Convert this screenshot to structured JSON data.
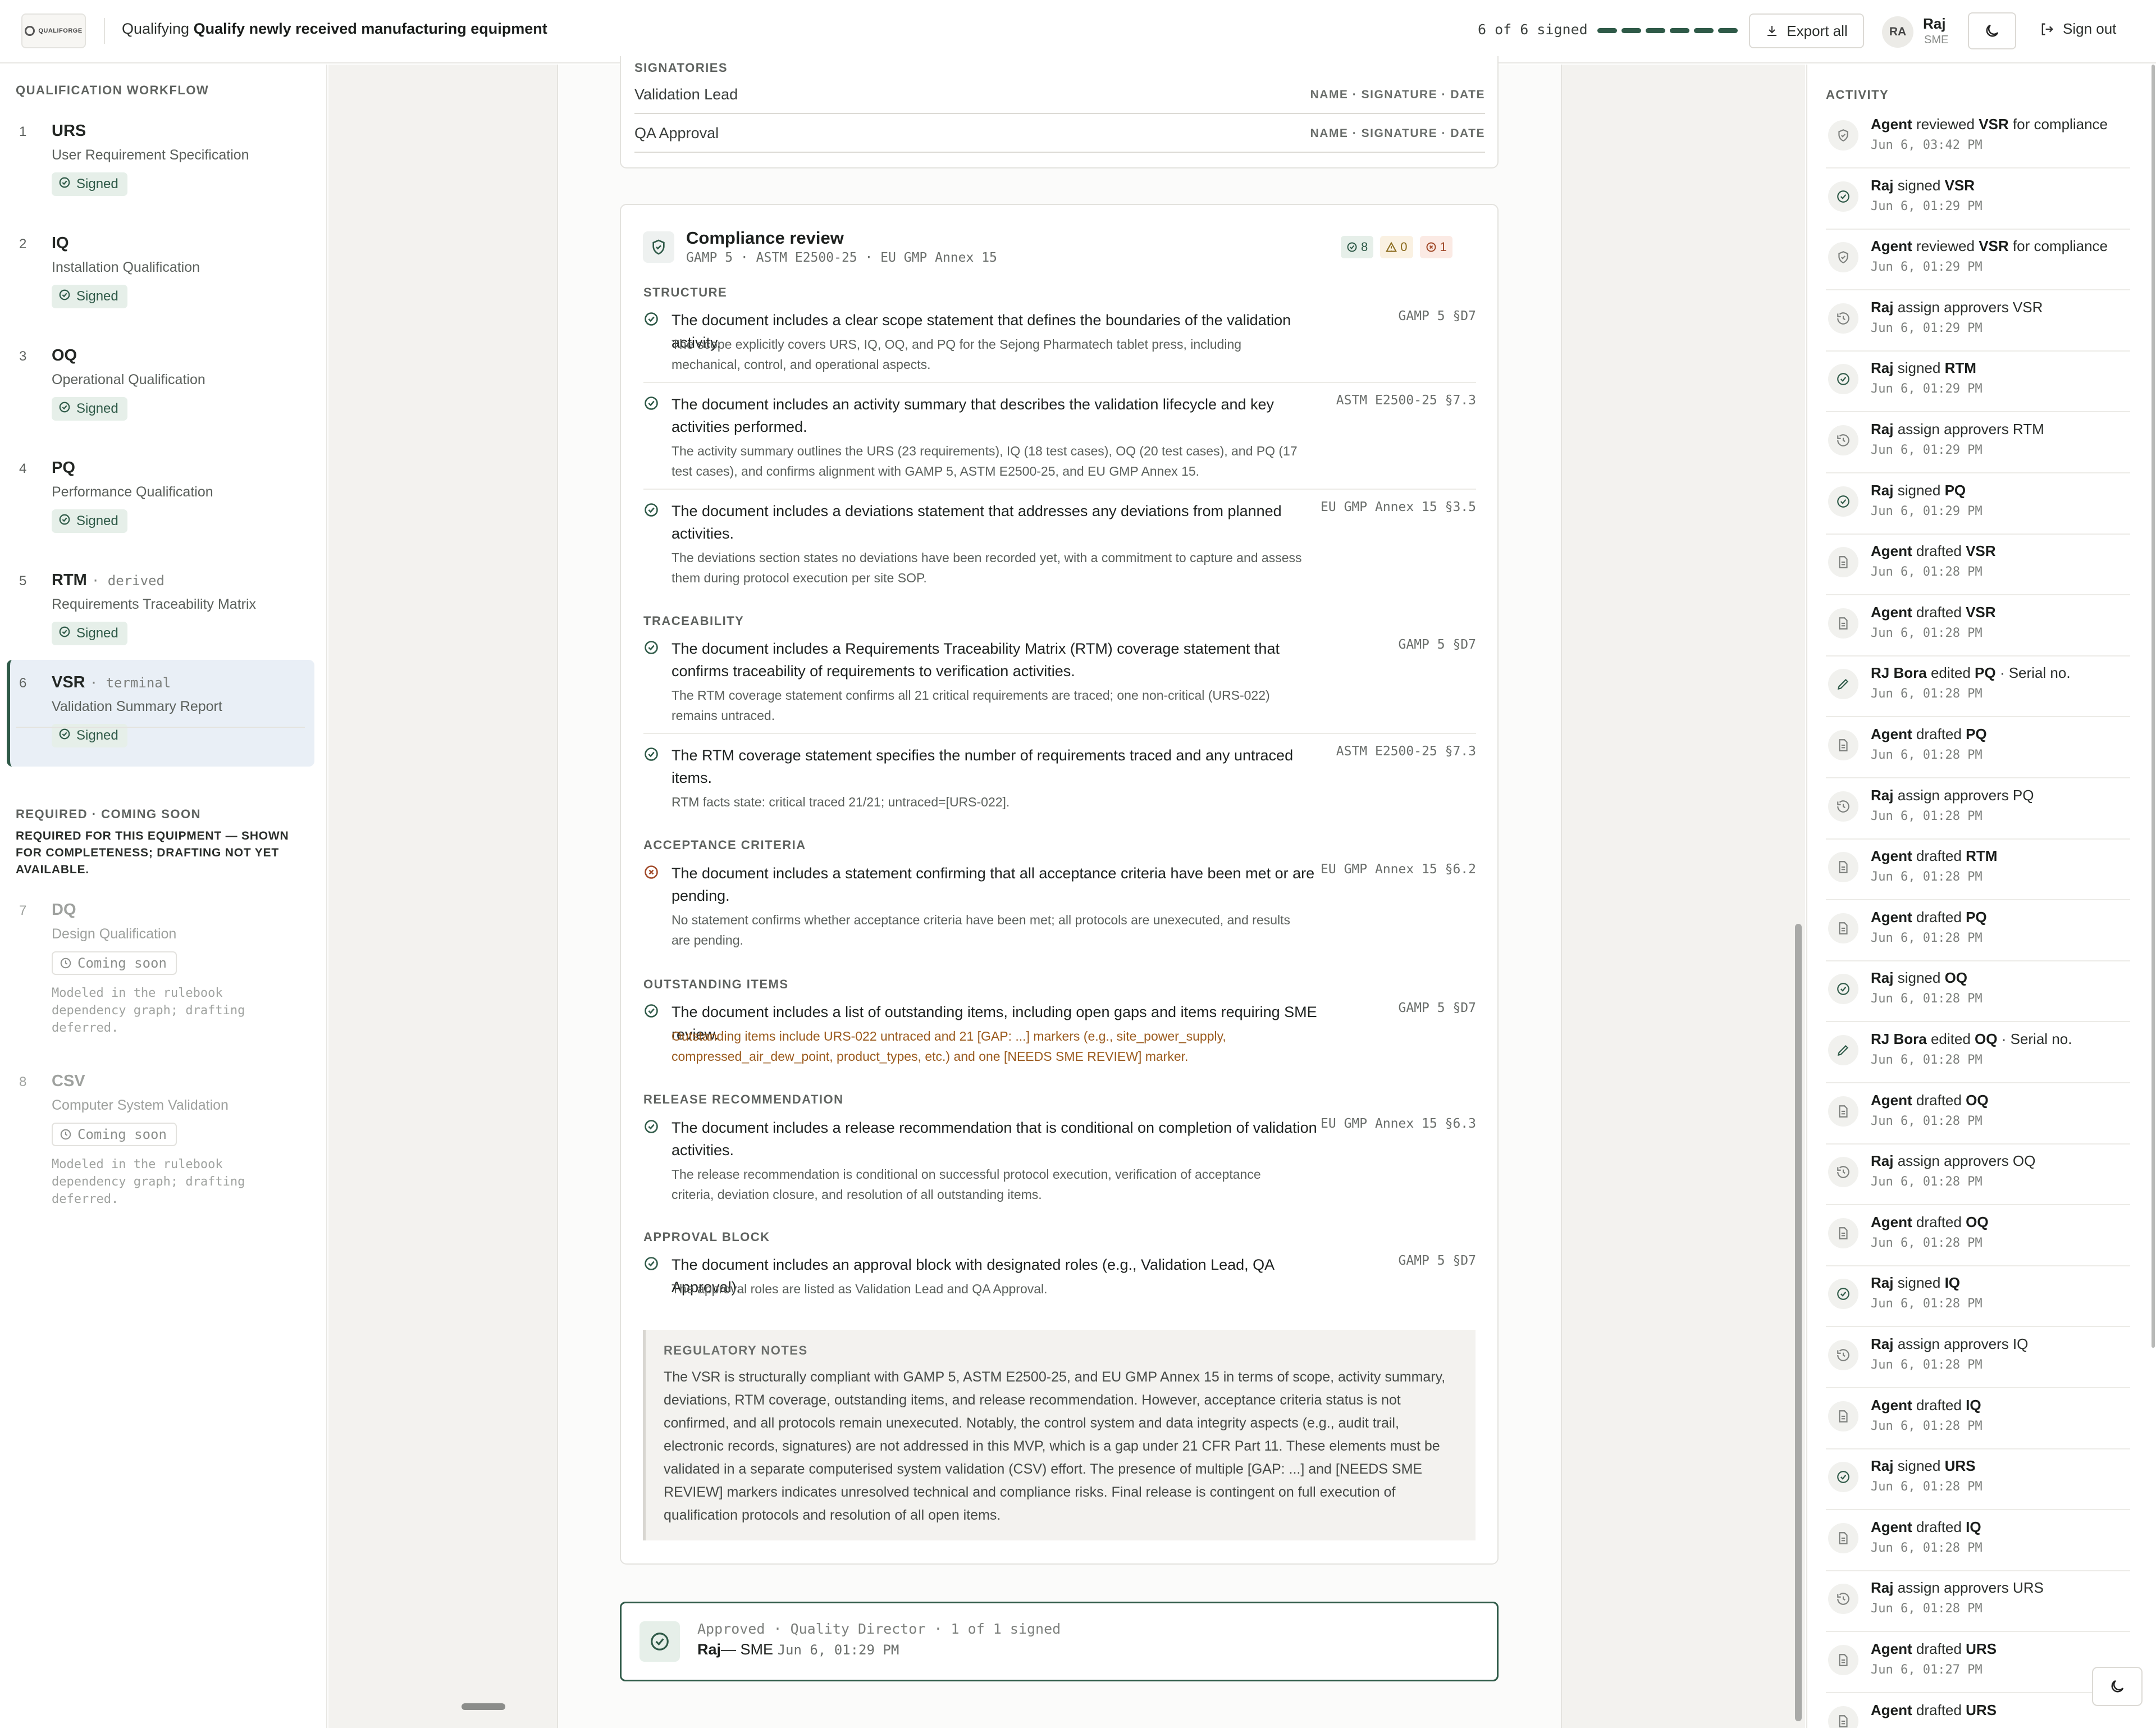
{
  "header": {
    "prefix": "Qualifying",
    "title": "Qualify newly received manufacturing equipment",
    "sign_status": "6 of 6 signed",
    "signed_count": 6,
    "total_count": 6,
    "export_label": "Export all",
    "user_initials": "RA",
    "user_name": "Raj",
    "user_role": "SME",
    "signout_label": "Sign out"
  },
  "sidebar": {
    "workflow_title": "QUALIFICATION WORKFLOW",
    "steps": [
      {
        "num": "1",
        "code": "URS",
        "tag": "",
        "name": "User Requirement Specification",
        "status": "Signed"
      },
      {
        "num": "2",
        "code": "IQ",
        "tag": "",
        "name": "Installation Qualification",
        "status": "Signed"
      },
      {
        "num": "3",
        "code": "OQ",
        "tag": "",
        "name": "Operational Qualification",
        "status": "Signed"
      },
      {
        "num": "4",
        "code": "PQ",
        "tag": "",
        "name": "Performance Qualification",
        "status": "Signed"
      },
      {
        "num": "5",
        "code": "RTM",
        "tag": "· derived",
        "name": "Requirements Traceability Matrix",
        "status": "Signed"
      },
      {
        "num": "6",
        "code": "VSR",
        "tag": "· terminal",
        "name": "Validation Summary Report",
        "status": "Signed"
      }
    ],
    "coming_title": "REQUIRED · COMING SOON",
    "coming_note": "REQUIRED FOR THIS EQUIPMENT — SHOWN FOR COMPLETENESS; DRAFTING NOT YET AVAILABLE.",
    "coming": [
      {
        "num": "7",
        "code": "DQ",
        "name": "Design Qualification",
        "status": "Coming soon",
        "note": "Modeled in the rulebook dependency graph; drafting deferred."
      },
      {
        "num": "8",
        "code": "CSV",
        "name": "Computer System Validation",
        "status": "Coming soon",
        "note": "Modeled in the rulebook dependency graph; drafting deferred."
      }
    ]
  },
  "signatories": {
    "title": "SIGNATORIES",
    "rows": [
      {
        "role": "Validation Lead",
        "hint": "NAME · SIGNATURE · DATE"
      },
      {
        "role": "QA Approval",
        "hint": "NAME · SIGNATURE · DATE"
      }
    ]
  },
  "compliance": {
    "title": "Compliance review",
    "standards": "GAMP 5 · ASTM E2500-25 · EU GMP Annex 15",
    "count_ok": "8",
    "count_warn": "0",
    "count_err": "1",
    "sections": [
      {
        "label": "STRUCTURE"
      },
      {
        "label": "TRACEABILITY"
      },
      {
        "label": "ACCEPTANCE CRITERIA"
      },
      {
        "label": "OUTSTANDING ITEMS"
      },
      {
        "label": "RELEASE RECOMMENDATION"
      },
      {
        "label": "APPROVAL BLOCK"
      }
    ],
    "items": [
      {
        "status": "pass",
        "claim": "The document includes a clear scope statement that defines the boundaries of the validation activity.",
        "ref": "GAMP 5 §D7",
        "detail": "The scope explicitly covers URS, IQ, OQ, and PQ for the Sejong Pharmatech tablet press, including mechanical, control, and operational aspects."
      },
      {
        "status": "pass",
        "claim": "The document includes an activity summary that describes the validation lifecycle and key activities performed.",
        "ref": "ASTM E2500-25 §7.3",
        "detail": "The activity summary outlines the URS (23 requirements), IQ (18 test cases), OQ (20 test cases), and PQ (17 test cases), and confirms alignment with GAMP 5, ASTM E2500-25, and EU GMP Annex 15."
      },
      {
        "status": "pass",
        "claim": "The document includes a deviations statement that addresses any deviations from planned activities.",
        "ref": "EU GMP Annex 15 §3.5",
        "detail": "The deviations section states no deviations have been recorded yet, with a commitment to capture and assess them during protocol execution per site SOP."
      },
      {
        "status": "pass",
        "claim": "The document includes a Requirements Traceability Matrix (RTM) coverage statement that confirms traceability of requirements to verification activities.",
        "ref": "GAMP 5 §D7",
        "detail": "The RTM coverage statement confirms all 21 critical requirements are traced; one non-critical (URS-022) remains untraced."
      },
      {
        "status": "pass",
        "claim": "The RTM coverage statement specifies the number of requirements traced and any untraced items.",
        "ref": "ASTM E2500-25 §7.3",
        "detail": "RTM facts state: critical traced 21/21; untraced=[URS-022]."
      },
      {
        "status": "fail",
        "claim": "The document includes a statement confirming that all acceptance criteria have been met or are pending.",
        "ref": "EU GMP Annex 15 §6.2",
        "detail": "No statement confirms whether acceptance criteria have been met; all protocols are unexecuted, and results are pending."
      },
      {
        "status": "pass",
        "claim": "The document includes a list of outstanding items, including open gaps and items requiring SME review.",
        "ref": "GAMP 5 §D7",
        "detail": "Outstanding items include URS-022 untraced and 21 [GAP: ...] markers (e.g., site_power_supply, compressed_air_dew_point, product_types, etc.) and one [NEEDS SME REVIEW] marker."
      },
      {
        "status": "pass",
        "claim": "The document includes a release recommendation that is conditional on completion of validation activities.",
        "ref": "EU GMP Annex 15 §6.3",
        "detail": "The release recommendation is conditional on successful protocol execution, verification of acceptance criteria, deviation closure, and resolution of all outstanding items."
      },
      {
        "status": "pass",
        "claim": "The document includes an approval block with designated roles (e.g., Validation Lead, QA Approval).",
        "ref": "GAMP 5 §D7",
        "detail": "The approval roles are listed as Validation Lead and QA Approval."
      }
    ],
    "reg_title": "REGULATORY NOTES",
    "reg_body": "The VSR is structurally compliant with GAMP 5, ASTM E2500-25, and EU GMP Annex 15 in terms of scope, activity summary, deviations, RTM coverage, outstanding items, and release recommendation. However, acceptance criteria status is not confirmed, and all protocols remain unexecuted. Notably, the control system and data integrity aspects (e.g., audit trail, electronic records, signatures) are not addressed in this MVP, which is a gap under 21 CFR Part 11. These elements must be validated in a separate computerised system validation (CSV) effort. The presence of multiple [GAP: ...] and [NEEDS SME REVIEW] markers indicates unresolved technical and compliance risks. Final release is contingent on full execution of qualification protocols and resolution of all open items."
  },
  "approval": {
    "line1": "Approved · Quality Director · 1 of 1 signed",
    "signer": "Raj",
    "role": "— SME",
    "date": "Jun 6, 01:29 PM"
  },
  "activity": {
    "title": "ACTIVITY",
    "items": [
      {
        "icon": "shield",
        "actor": "Agent",
        "verb": "reviewed",
        "target": "VSR",
        "suffix": "for compliance",
        "date": "Jun 6, 03:42 PM"
      },
      {
        "icon": "check",
        "actor": "Raj",
        "verb": "signed",
        "target": "VSR",
        "suffix": "",
        "date": "Jun 6, 01:29 PM"
      },
      {
        "icon": "shield",
        "actor": "Agent",
        "verb": "reviewed",
        "target": "VSR",
        "suffix": "for compliance",
        "date": "Jun 6, 01:29 PM"
      },
      {
        "icon": "history",
        "actor": "Raj",
        "verb": "assign approvers VSR",
        "target": "",
        "suffix": "",
        "date": "Jun 6, 01:29 PM"
      },
      {
        "icon": "check",
        "actor": "Raj",
        "verb": "signed",
        "target": "RTM",
        "suffix": "",
        "date": "Jun 6, 01:29 PM"
      },
      {
        "icon": "history",
        "actor": "Raj",
        "verb": "assign approvers RTM",
        "target": "",
        "suffix": "",
        "date": "Jun 6, 01:29 PM"
      },
      {
        "icon": "check",
        "actor": "Raj",
        "verb": "signed",
        "target": "PQ",
        "suffix": "",
        "date": "Jun 6, 01:29 PM"
      },
      {
        "icon": "doc",
        "actor": "Agent",
        "verb": "drafted",
        "target": "VSR",
        "suffix": "",
        "date": "Jun 6, 01:28 PM"
      },
      {
        "icon": "doc",
        "actor": "Agent",
        "verb": "drafted",
        "target": "VSR",
        "suffix": "",
        "date": "Jun 6, 01:28 PM"
      },
      {
        "icon": "pencil",
        "actor": "RJ Bora",
        "verb": "edited",
        "target": "PQ",
        "suffix": "· Serial no.",
        "date": "Jun 6, 01:28 PM"
      },
      {
        "icon": "doc",
        "actor": "Agent",
        "verb": "drafted",
        "target": "PQ",
        "suffix": "",
        "date": "Jun 6, 01:28 PM"
      },
      {
        "icon": "history",
        "actor": "Raj",
        "verb": "assign approvers PQ",
        "target": "",
        "suffix": "",
        "date": "Jun 6, 01:28 PM"
      },
      {
        "icon": "doc",
        "actor": "Agent",
        "verb": "drafted",
        "target": "RTM",
        "suffix": "",
        "date": "Jun 6, 01:28 PM"
      },
      {
        "icon": "doc",
        "actor": "Agent",
        "verb": "drafted",
        "target": "PQ",
        "suffix": "",
        "date": "Jun 6, 01:28 PM"
      },
      {
        "icon": "check",
        "actor": "Raj",
        "verb": "signed",
        "target": "OQ",
        "suffix": "",
        "date": "Jun 6, 01:28 PM"
      },
      {
        "icon": "pencil",
        "actor": "RJ Bora",
        "verb": "edited",
        "target": "OQ",
        "suffix": "· Serial no.",
        "date": "Jun 6, 01:28 PM"
      },
      {
        "icon": "doc",
        "actor": "Agent",
        "verb": "drafted",
        "target": "OQ",
        "suffix": "",
        "date": "Jun 6, 01:28 PM"
      },
      {
        "icon": "history",
        "actor": "Raj",
        "verb": "assign approvers OQ",
        "target": "",
        "suffix": "",
        "date": "Jun 6, 01:28 PM"
      },
      {
        "icon": "doc",
        "actor": "Agent",
        "verb": "drafted",
        "target": "OQ",
        "suffix": "",
        "date": "Jun 6, 01:28 PM"
      },
      {
        "icon": "check",
        "actor": "Raj",
        "verb": "signed",
        "target": "IQ",
        "suffix": "",
        "date": "Jun 6, 01:28 PM"
      },
      {
        "icon": "history",
        "actor": "Raj",
        "verb": "assign approvers IQ",
        "target": "",
        "suffix": "",
        "date": "Jun 6, 01:28 PM"
      },
      {
        "icon": "doc",
        "actor": "Agent",
        "verb": "drafted",
        "target": "IQ",
        "suffix": "",
        "date": "Jun 6, 01:28 PM"
      },
      {
        "icon": "check",
        "actor": "Raj",
        "verb": "signed",
        "target": "URS",
        "suffix": "",
        "date": "Jun 6, 01:28 PM"
      },
      {
        "icon": "doc",
        "actor": "Agent",
        "verb": "drafted",
        "target": "IQ",
        "suffix": "",
        "date": "Jun 6, 01:28 PM"
      },
      {
        "icon": "history",
        "actor": "Raj",
        "verb": "assign approvers URS",
        "target": "",
        "suffix": "",
        "date": "Jun 6, 01:28 PM"
      },
      {
        "icon": "doc",
        "actor": "Agent",
        "verb": "drafted",
        "target": "URS",
        "suffix": "",
        "date": "Jun 6, 01:27 PM"
      },
      {
        "icon": "doc",
        "actor": "Agent",
        "verb": "drafted",
        "target": "URS",
        "suffix": "",
        "date": ""
      }
    ]
  },
  "colors": {
    "accent": "#2f5a48",
    "fail": "#a14a2a",
    "warn": "#9a5a1d",
    "active_bg": "#e9eff6"
  }
}
